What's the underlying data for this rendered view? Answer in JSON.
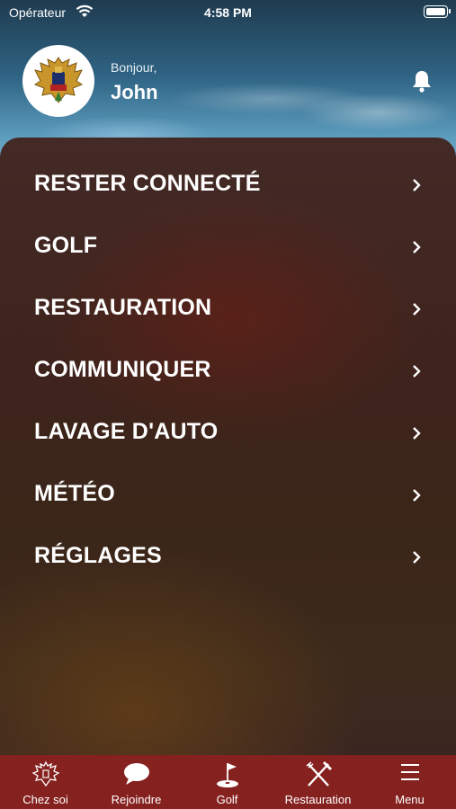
{
  "status_bar": {
    "carrier": "Opérateur",
    "time": "4:58 PM"
  },
  "header": {
    "greeting": "Bonjour,",
    "username": "John"
  },
  "menu": {
    "items": [
      {
        "label": "RESTER CONNECTÉ"
      },
      {
        "label": "GOLF"
      },
      {
        "label": "RESTAURATION"
      },
      {
        "label": "COMMUNIQUER"
      },
      {
        "label": "LAVAGE D'AUTO"
      },
      {
        "label": "MÉTÉO"
      },
      {
        "label": "RÉGLAGES"
      }
    ]
  },
  "tab_bar": {
    "tabs": [
      {
        "label": "Chez soi",
        "icon": "crest-icon"
      },
      {
        "label": "Rejoindre",
        "icon": "chat-bubble-icon"
      },
      {
        "label": "Golf",
        "icon": "golf-flag-icon"
      },
      {
        "label": "Restauration",
        "icon": "fork-knife-icon"
      },
      {
        "label": "Menu",
        "icon": "hamburger-icon"
      }
    ]
  },
  "colors": {
    "tab_bar": "#85211f",
    "panel": "#3e241d",
    "text": "#ffffff"
  }
}
